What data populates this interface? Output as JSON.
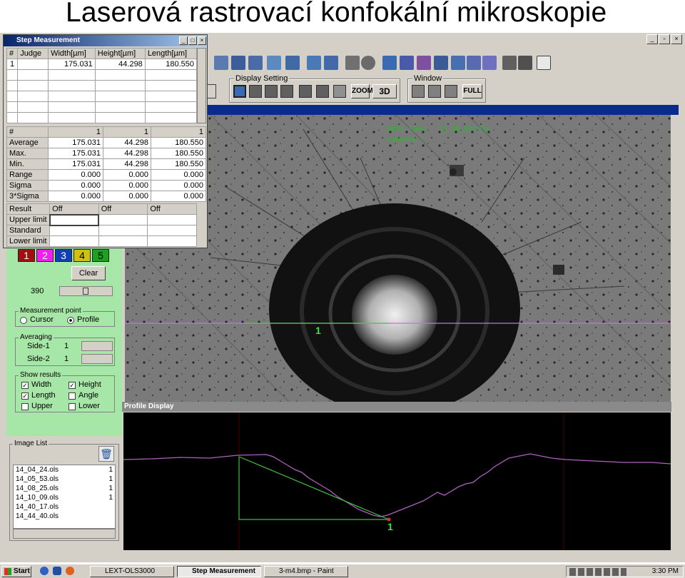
{
  "slide_title": "Laserová rastrovací konfokální mikroskopie",
  "dialog": {
    "title": "Step Measurement",
    "columns": [
      "#",
      "Judge",
      "Width[µm]",
      "Height[µm]",
      "Length[µm]"
    ],
    "row1": {
      "num": "1",
      "width": "175.031",
      "height": "44.298",
      "length": "180.550"
    },
    "stats_header": [
      "#",
      "1",
      "1",
      "1"
    ],
    "stats": [
      {
        "label": "Average",
        "w": "175.031",
        "h": "44.298",
        "l": "180.550"
      },
      {
        "label": "Max.",
        "w": "175.031",
        "h": "44.298",
        "l": "180.550"
      },
      {
        "label": "Min.",
        "w": "175.031",
        "h": "44.298",
        "l": "180.550"
      },
      {
        "label": "Range",
        "w": "0.000",
        "h": "0.000",
        "l": "0.000"
      },
      {
        "label": "Sigma",
        "w": "0.000",
        "h": "0.000",
        "l": "0.000"
      },
      {
        "label": "3*Sigma",
        "w": "0.000",
        "h": "0.000",
        "l": "0.000"
      }
    ],
    "result_label": "Result",
    "result_values": [
      "Off",
      "Off",
      "Off"
    ],
    "upper_limit": "Upper limit",
    "standard": "Standard",
    "lower_limit": "Lower limit"
  },
  "toolbar": {
    "display_setting": "Display Setting",
    "window": "Window",
    "zoom": "ZOOM",
    "threeD": "3D",
    "full": "FULL"
  },
  "left_panel": {
    "color_buttons": [
      "1",
      "2",
      "3",
      "4",
      "5"
    ],
    "clear": "Clear",
    "slider_value": "390",
    "measurement_point": "Measurement point",
    "cursor": "Cursor",
    "profile": "Profile",
    "averaging": "Averaging",
    "side1": "Side-1",
    "side1_value": "1",
    "side2": "Side-2",
    "side2_value": "1",
    "show_results": "Show results",
    "width": "Width",
    "height": "Height",
    "length": "Length",
    "angle": "Angle",
    "upper": "Upper",
    "lower": "Lower",
    "image_list": "Image List",
    "files": [
      {
        "name": "14_04_24.ols",
        "n": "1"
      },
      {
        "name": "14_05_53.ols",
        "n": "1"
      },
      {
        "name": "14_08_25.ols",
        "n": "1"
      },
      {
        "name": "14_10_09.ols",
        "n": "1"
      },
      {
        "name": "14_40_17.ols",
        "n": ""
      },
      {
        "name": "14_44_40.ols",
        "n": ""
      }
    ]
  },
  "image": {
    "marker": "1",
    "overlay1": "Data name : 14_10_09.ols",
    "overlay2": "Comment :"
  },
  "profile_display": {
    "title": "Profile Display",
    "marker": "1"
  },
  "taskbar": {
    "start": "Start",
    "tasks": [
      "LEXT-OLS3000",
      "Step Measurement",
      "3-m4.bmp - Paint"
    ],
    "clock": "3:30 PM"
  }
}
